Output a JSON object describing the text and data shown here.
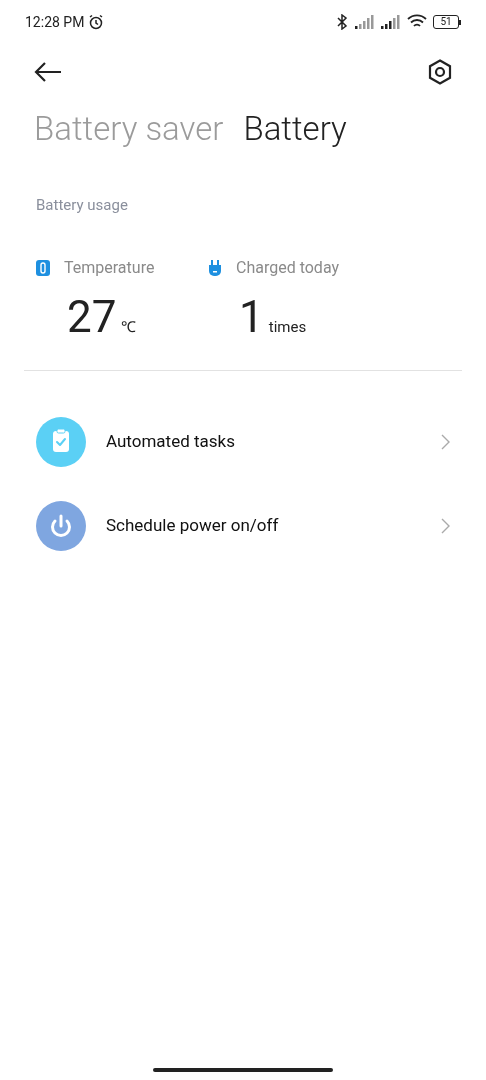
{
  "status_bar": {
    "time": "12:28 PM",
    "battery": "51"
  },
  "tabs": [
    {
      "label": "Battery saver",
      "selected": false
    },
    {
      "label": "Battery",
      "selected": true
    }
  ],
  "section_title": "Battery usage",
  "stats": [
    {
      "kind": "temperature",
      "label": "Temperature",
      "value": "27",
      "unit": "℃"
    },
    {
      "kind": "charge",
      "label": "Charged today",
      "value": "1",
      "unit": "times"
    }
  ],
  "items": [
    {
      "kind": "tasks",
      "label": "Automated tasks",
      "color": "#5bd0f5"
    },
    {
      "kind": "power",
      "label": "Schedule power on/off",
      "color": "#7fa6e0"
    }
  ]
}
